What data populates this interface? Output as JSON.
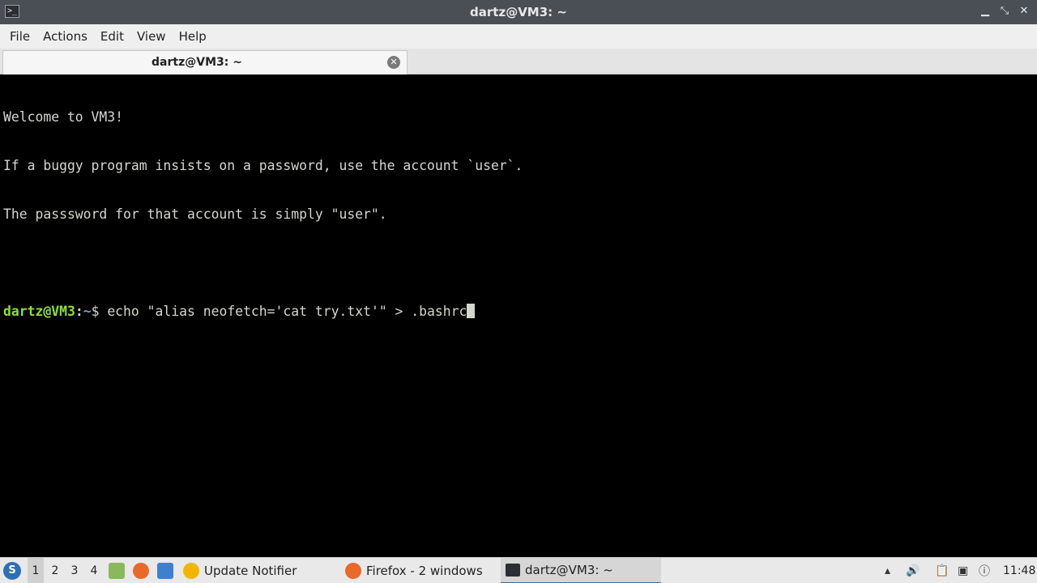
{
  "window": {
    "title": "dartz@VM3: ~",
    "icon": "terminal-icon",
    "controls": [
      "minimize-icon",
      "restore-icon",
      "close-icon"
    ]
  },
  "menubar": {
    "items": [
      "File",
      "Actions",
      "Edit",
      "View",
      "Help"
    ]
  },
  "tabs": [
    {
      "label": "dartz@VM3: ~",
      "close_icon": "close-circle-icon"
    }
  ],
  "terminal": {
    "lines": [
      "Welcome to VM3!",
      "If a buggy program insists on a password, use the account `user`.",
      "The passsword for that account is simply \"user\".",
      ""
    ],
    "prompt": {
      "user_host": "dartz@VM3",
      "separator": ":",
      "path": "~",
      "symbol": "$ ",
      "command": "echo \"alias neofetch='cat try.txt'\" > .bashrc"
    },
    "colors": {
      "prompt_user": "#8ae234",
      "prompt_path": "#729fcf",
      "text": "#d3d7cf"
    }
  },
  "taskbar": {
    "desktops": [
      "1",
      "2",
      "3",
      "4"
    ],
    "active_desktop": "1",
    "tasks": [
      {
        "label": "Update Notifier",
        "icon": "update-notifier-icon"
      },
      {
        "label": "Firefox - 2 windows",
        "icon": "firefox-icon"
      },
      {
        "label": "dartz@VM3: ~",
        "icon": "terminal-icon"
      }
    ],
    "clock": "11:48"
  }
}
